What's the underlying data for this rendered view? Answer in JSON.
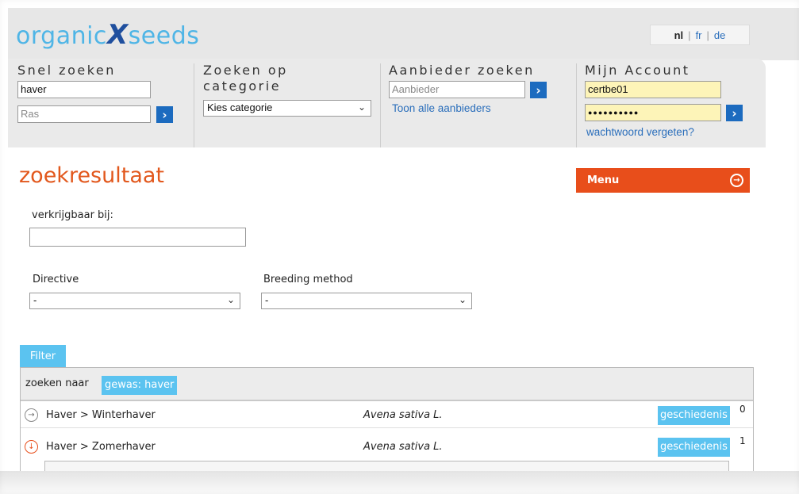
{
  "brand": {
    "logo_part1": "organic",
    "logo_x": "X",
    "logo_part2": "seeds"
  },
  "languages": {
    "active": "nl",
    "other1": "fr",
    "other2": "de",
    "separator": "|"
  },
  "quick_search": {
    "title": "Snel zoeken",
    "field1_value": "haver",
    "field2_placeholder": "Ras"
  },
  "category_search": {
    "title_line1": "Zoeken op",
    "title_line2": "categorie",
    "select_value": "Kies categorie"
  },
  "supplier_search": {
    "title": "Aanbieder zoeken",
    "placeholder": "Aanbieder",
    "show_all_link": "Toon alle aanbieders"
  },
  "account": {
    "title": "Mijn Account",
    "username": "certbe01",
    "password_mask": "●●●●●●●●●●",
    "forgot_link": "wachtwoord vergeten?"
  },
  "go_glyph": "›",
  "page": {
    "title": "zoekresultaat",
    "menu_label": "Menu",
    "menu_icon": "→"
  },
  "filters": {
    "available_at_label": "verkrijgbaar bij:",
    "directive_label": "Directive",
    "directive_value": "-",
    "breeding_label": "Breeding method",
    "breeding_value": "-",
    "filter_tab": "Filter"
  },
  "search_summary": {
    "label": "zoeken naar",
    "tag": "gewas: haver"
  },
  "results": [
    {
      "path": "Haver > Winterhaver",
      "latin": "Avena sativa L.",
      "history": "geschiedenis",
      "count": "0",
      "expanded": false,
      "icon": "→"
    },
    {
      "path": "Haver > Zomerhaver",
      "latin": "Avena sativa L.",
      "history": "geschiedenis",
      "count": "1",
      "expanded": true,
      "icon": "↓"
    }
  ],
  "colors": {
    "brand_blue": "#4fb5e6",
    "accent_orange": "#e84e1b",
    "tag_blue": "#5bc3f0",
    "button_blue": "#1c6bbf"
  }
}
